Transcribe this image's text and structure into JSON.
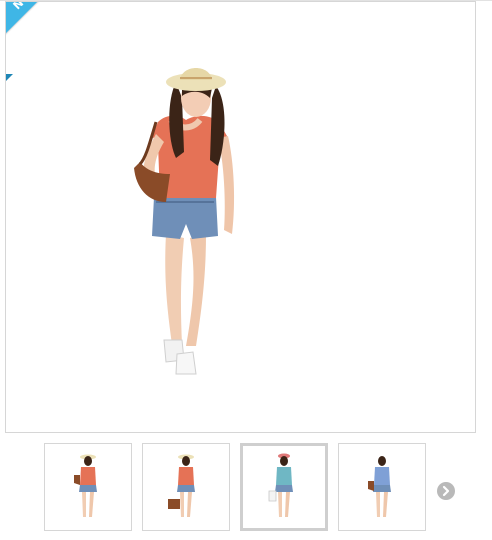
{
  "product_gallery": {
    "badge": {
      "label": "NOUVEAU",
      "color": "#3fb6e6"
    },
    "main_image": {
      "subject": "model-straw-hat-coral-top-denim-shorts-brown-bag"
    },
    "thumbnails": [
      {
        "subject": "model-coral-top-front"
      },
      {
        "subject": "model-coral-top-holding-bag"
      },
      {
        "subject": "model-teal-top-white-bag",
        "selected": true
      },
      {
        "subject": "model-blue-top-brown-bag"
      }
    ],
    "next_icon": "chevron-right-icon"
  }
}
